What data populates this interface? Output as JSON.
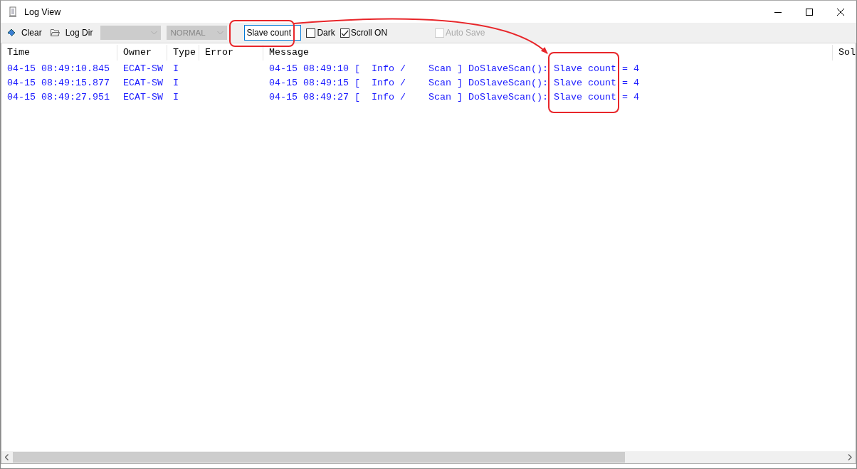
{
  "window": {
    "title": "Log View"
  },
  "toolbar": {
    "buttons": [
      {
        "label": "Clear",
        "kind": "eraser"
      },
      {
        "label": "Log Dir",
        "kind": "folder"
      }
    ],
    "dropdowns": [
      {
        "disabled": true
      },
      {
        "value": "NORMAL",
        "disabled": true
      }
    ],
    "search": {
      "value": "Slave count"
    },
    "checkboxes": [
      {
        "label": "Dark",
        "checked": false,
        "disabled": false
      },
      {
        "label": "Scroll ON",
        "checked": true,
        "disabled": false
      },
      {
        "label": "Auto Save",
        "checked": false,
        "disabled": true
      }
    ]
  },
  "table": {
    "columns": [
      "Time",
      "Owner",
      "Type",
      "Error",
      "Message",
      "Sol"
    ],
    "rows": [
      {
        "cells": [
          "04-15 08:49:10.845",
          "ECAT-SW",
          "I",
          "",
          "04-15 08:49:10 [  Info /    Scan ] DoSlaveScan(): Slave count = 4"
        ]
      },
      {
        "cells": [
          "04-15 08:49:15.877",
          "ECAT-SW",
          "I",
          "",
          "04-15 08:49:15 [  Info /    Scan ] DoSlaveScan(): Slave count = 4"
        ]
      },
      {
        "cells": [
          "04-15 08:49:27.951",
          "ECAT-SW",
          "I",
          "",
          "04-15 08:49:27 [  Info /    Scan ] DoSlaveScan(): Slave count = 4"
        ]
      }
    ]
  }
}
